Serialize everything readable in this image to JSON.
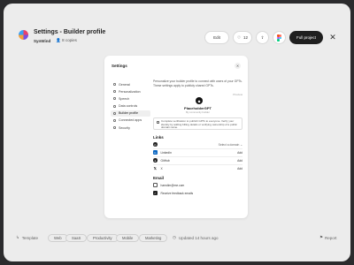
{
  "header": {
    "title": "Settings - Builder profile",
    "brand": "SynWind",
    "people": "8 copies",
    "edit_label": "Edit",
    "like_count": "12",
    "full_project_label": "Full project",
    "close_glyph": "✕"
  },
  "settings": {
    "title": "Settings",
    "close_glyph": "✕",
    "nav": [
      {
        "label": "General"
      },
      {
        "label": "Personalization"
      },
      {
        "label": "Speech"
      },
      {
        "label": "Data controls"
      },
      {
        "label": "Builder profile"
      },
      {
        "label": "Connected apps"
      },
      {
        "label": "Security"
      }
    ],
    "description": "Personalize your builder profile to connect with users of your GPTs. These settings apply to publicly shared GPTs.",
    "preview_tag": "Preview",
    "profile_name": "PlaceholderGPT",
    "profile_url": "By community builder",
    "verify_text": "Complete verification to publish GPTs to everyone. Verify your identity by adding billing details or verifying ownership of a public domain name.",
    "links_title": "Links",
    "links": [
      {
        "icon": "globe-icon",
        "label": "",
        "action": "Select a domain ⌄"
      },
      {
        "icon": "linkedin-icon",
        "label": "LinkedIn",
        "action": "Add"
      },
      {
        "icon": "github-icon",
        "label": "GitHub",
        "action": "Add"
      },
      {
        "icon": "x-icon",
        "label": "X",
        "action": "Add"
      }
    ],
    "email_title": "Email",
    "emails": [
      {
        "label": "hamdim@me.com"
      },
      {
        "label": "Receive feedback emails"
      }
    ]
  },
  "footer": {
    "template_label": "Template",
    "tags": [
      "Web",
      "SaaS",
      "Productivity",
      "Mobile",
      "Marketing"
    ],
    "updated": "Updated 14 hours ago",
    "report": "Report"
  },
  "colors": {
    "accent_dark": "#1f1f1f",
    "linkedin": "#0a66c2",
    "background": "#ececec"
  }
}
